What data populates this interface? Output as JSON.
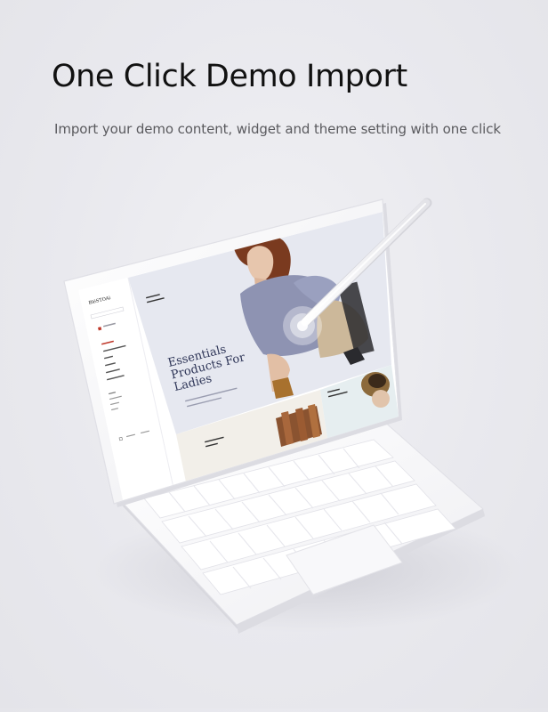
{
  "hero": {
    "title": "One Click Demo Import",
    "subtitle": "Import your demo content, widget and theme setting with one click"
  },
  "screen": {
    "logo": "BléSTOAi",
    "hero_heading_line1": "Essentials",
    "hero_heading_line2": "Products For",
    "hero_heading_line3": "Ladies"
  },
  "colors": {
    "background": "#e9e9ee",
    "heading": "#111111",
    "subtitle": "#5a5a5e",
    "device": "#fbfbfc",
    "screen_hero": "#e6e8f0",
    "accent_text": "#2e3557",
    "sidebar_accent": "#c0392b"
  }
}
